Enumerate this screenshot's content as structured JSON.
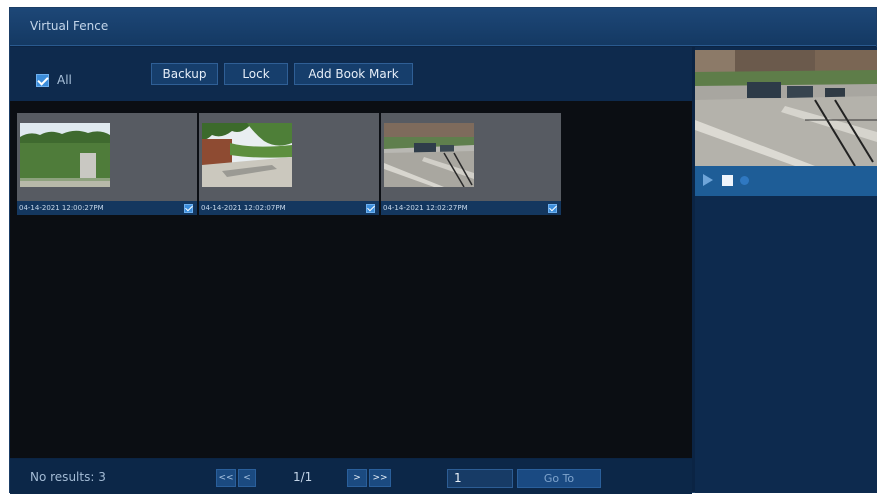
{
  "window": {
    "title": "Virtual Fence"
  },
  "toolbar": {
    "select_all_label": "All",
    "backup_label": "Backup",
    "lock_label": "Lock",
    "bookmark_label": "Add Book Mark"
  },
  "results": [
    {
      "timestamp": "04-14-2021 12:00:27PM",
      "checked": true
    },
    {
      "timestamp": "04-14-2021 12:02:07PM",
      "checked": true
    },
    {
      "timestamp": "04-14-2021 12:02:27PM",
      "checked": true
    }
  ],
  "footer": {
    "count_text": "No results: 3",
    "first_label": "<<",
    "prev_label": "<",
    "page_text": "1/1",
    "next_label": ">",
    "last_label": ">>",
    "goto_value": "1",
    "goto_label": "Go To"
  },
  "preview_controls": {
    "play": "play-icon",
    "stop": "stop-icon",
    "indicator": "status-dot-icon"
  },
  "colors": {
    "window_bg": "#0b2444",
    "accent": "#3c8dda",
    "results_bg": "#0b0e13"
  }
}
